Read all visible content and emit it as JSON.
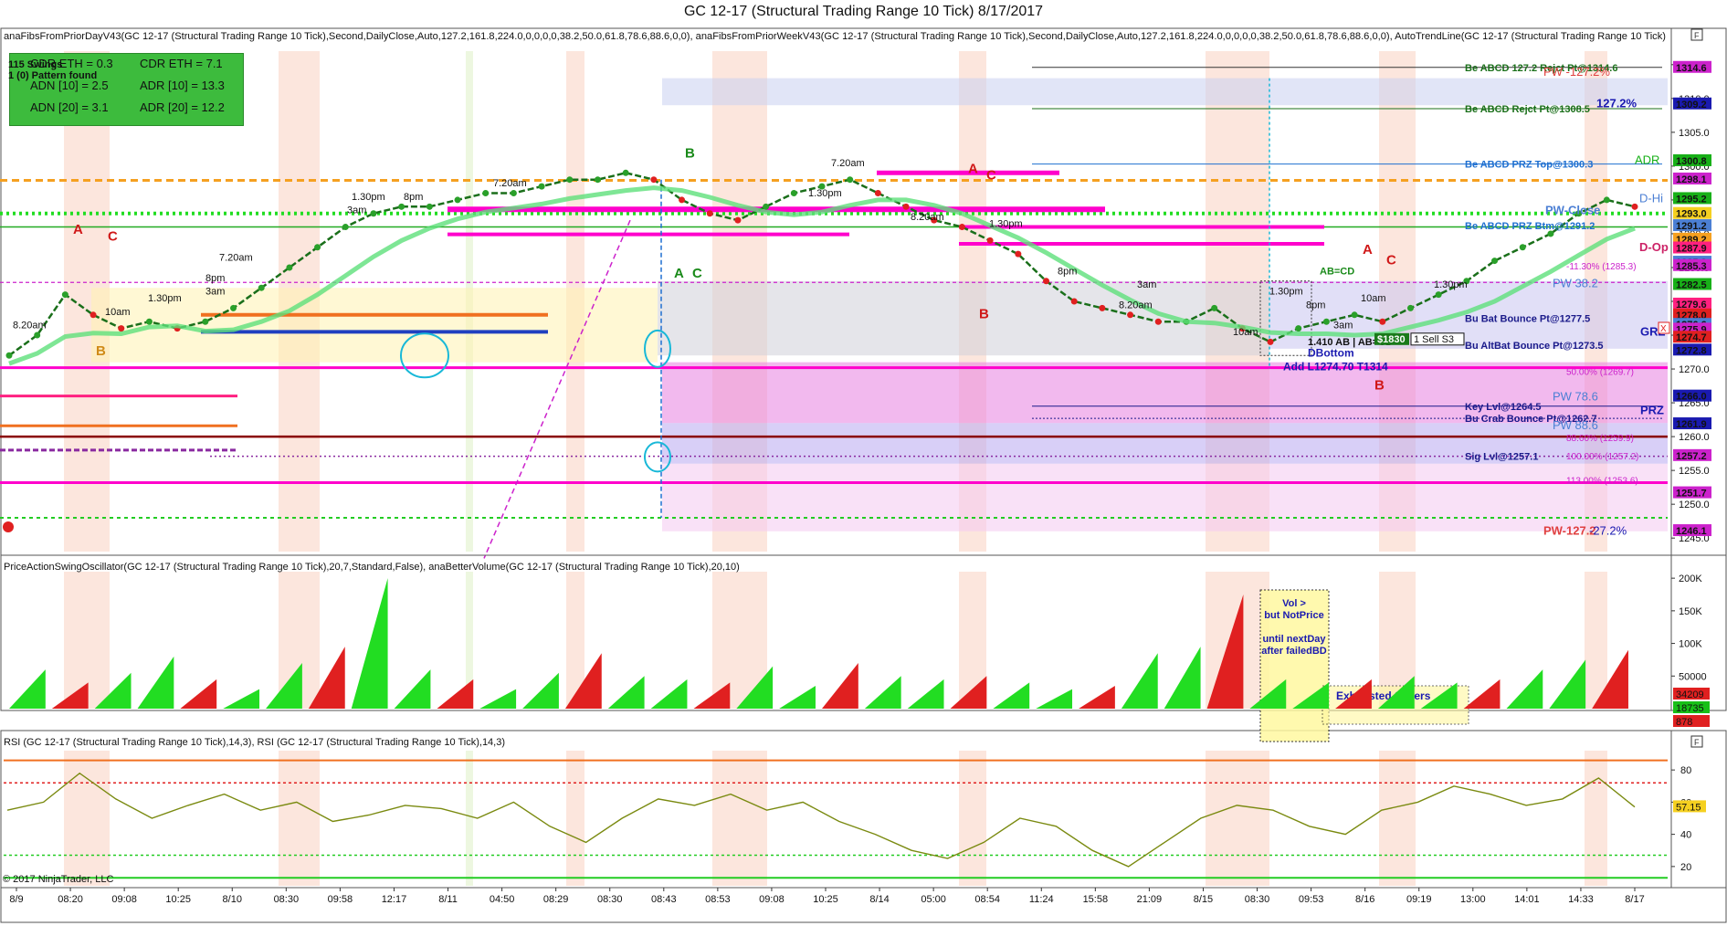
{
  "window": {
    "title": "GC 12-17 (Structural Trading Range 10 Tick)  8/17/2017",
    "copyright": "© 2017 NinjaTrader, LLC"
  },
  "price_panel": {
    "indicator_header": "anaFibsFromPriorDayV43(GC 12-17 (Structural Trading Range 10 Tick),Second,DailyClose,Auto,127.2,161.8,224.0,0,0,0,0,38.2,50.0,61.8,78.6,88.6,0,0), anaFibsFromPriorWeekV43(GC 12-17 (Structural Trading Range 10 Tick),Second,DailyClose,Auto,127.2,161.8,224.0,0,0,0,0,38.2,50.0,61.8,78.6,88.6,0,0), AutoTrendLine(GC 12-17 (Structural Trading Range 10 Tick)",
    "stats": {
      "swings": "115 Swings",
      "pattern": "1 (0) Pattern found",
      "cdr_eth_a": "CDR ETH = 0.3",
      "cdr_eth_b": "CDR ETH = 7.1",
      "adn10": "ADN [10] = 2.5",
      "adr10": "ADR [10] = 13.3",
      "adn20": "ADN [20] = 3.1",
      "adr20": "ADR [20] = 12.2"
    },
    "levels": [
      {
        "text": "Be ABCD 127.2 Rejct Pt@1314.6",
        "color": "#1a6f1a"
      },
      {
        "text": "Be ABCD Rejct Pt@1308.5",
        "color": "#1a6f1a"
      },
      {
        "text": "Be ABCD PRZ Top@1300.3",
        "color": "#1e6fd0"
      },
      {
        "text": "Be ABCD PRZ Btm@1291.2",
        "color": "#1e6fd0"
      },
      {
        "text": "Key Lvl@1264.5",
        "color": "#1a1a8a"
      },
      {
        "text": "Bu Crab Bounce Pt@1262.7",
        "color": "#1a1a8a"
      },
      {
        "text": "Sig Lvl@1257.1",
        "color": "#1a1a8a"
      },
      {
        "text": "Bu Bat Bounce Pt@1277.5",
        "color": "#1a1a8a"
      },
      {
        "text": "Bu AltBat Bounce Pt@1273.5",
        "color": "#1a1a8a"
      }
    ],
    "right_labels": [
      {
        "text": "PW -127.2%",
        "color": "#e04040"
      },
      {
        "text": "127.2%",
        "color": "#1a1ab0"
      },
      {
        "text": "ADR",
        "color": "#18b018"
      },
      {
        "text": "PW-Close",
        "color": "#4b7fd4"
      },
      {
        "text": "D-Hi",
        "color": "#4b7fd4"
      },
      {
        "text": "D-Op",
        "color": "#cc2266"
      },
      {
        "text": "PW 38.2",
        "color": "#4b7fd4"
      },
      {
        "text": "GRZ",
        "color": "#1a1ab0"
      },
      {
        "text": "PW 78.6",
        "color": "#4b7fd4"
      },
      {
        "text": "PRZ",
        "color": "#1a1ab0"
      },
      {
        "text": "PW 88.6",
        "color": "#4b7fd4"
      },
      {
        "text": "PW-127.2",
        "color": "#e04040"
      },
      {
        "text": "-27.2%",
        "color": "#1a1ab0"
      }
    ],
    "annotations": {
      "dbottom": "DBottom",
      "add_order": "Add L1274.70 T1314",
      "ab_cd": "1.410 AB | AB=CD",
      "price_tag": "$1830",
      "sell_tag": "1  Sell S3",
      "abcd": "AB=CD",
      "time_labels": [
        "8.20am",
        "10am",
        "1.30pm",
        "3am",
        "8pm",
        "7.20am",
        "1.30pm",
        "3am",
        "8pm",
        "7.20am",
        "1.30pm",
        "7.20am",
        "8.20am",
        "1.30pm",
        "8pm",
        "1.30pm",
        "10am",
        "3am",
        "8pm",
        "1.30pm",
        "3am",
        "8.20am",
        "10am"
      ],
      "letters": [
        {
          "text": "A",
          "color": "#d01818"
        },
        {
          "text": "C",
          "color": "#d01818"
        },
        {
          "text": "B",
          "color": "#d08a18"
        },
        {
          "text": "B",
          "color": "#1a8a1a"
        },
        {
          "text": "A",
          "color": "#1a8a1a"
        },
        {
          "text": "C",
          "color": "#1a8a1a"
        },
        {
          "text": "A",
          "color": "#d01818"
        },
        {
          "text": "C",
          "color": "#d01818"
        },
        {
          "text": "B",
          "color": "#d01818"
        },
        {
          "text": "A",
          "color": "#d01818"
        },
        {
          "text": "C",
          "color": "#d01818"
        },
        {
          "text": "B",
          "color": "#d01818"
        }
      ]
    }
  },
  "volume_panel": {
    "indicator_header": "PriceActionSwingOscillator(GC 12-17 (Structural Trading Range 10 Tick),20,7,Standard,False), anaBetterVolume(GC 12-17 (Structural Trading Range 10 Tick),20,10)",
    "callout_vol": [
      "Vol >",
      "but NotPrice",
      "",
      "until nextDay",
      "after failedBD"
    ],
    "callout_exhaust": "Exhausted Sellers",
    "readouts": [
      {
        "text": "34209",
        "color": "#e02020"
      },
      {
        "text": "18735",
        "color": "#18c018"
      },
      {
        "text": "878",
        "color": "#e02020"
      }
    ]
  },
  "rsi_panel": {
    "indicator_header": "RSI (GC 12-17 (Structural Trading Range 10 Tick),14,3), RSI (GC 12-17 (Structural Trading Range 10 Tick),14,3)",
    "readout": "57.15"
  },
  "colors": {
    "bull": "#22dd22",
    "bear": "#e02020",
    "rsi_line": "#7a8a10",
    "fib_magenta": "#ff00cc",
    "orange_dash": "#f5a020",
    "green_dot": "#22dd22"
  },
  "chart_data": [
    {
      "type": "line",
      "panel": "price",
      "x_labels": [
        "8/9",
        "08:20",
        "09:08",
        "10:25",
        "8/10",
        "08:30",
        "09:58",
        "12:17",
        "8/11",
        "04:50",
        "08:29",
        "08:30",
        "08:43",
        "08:53",
        "09:08",
        "10:25",
        "8/14",
        "05:00",
        "08:54",
        "11:24",
        "15:58",
        "21:09",
        "8/15",
        "08:30",
        "09:53",
        "8/16",
        "09:19",
        "13:00",
        "14:01",
        "14:33",
        "8/17"
      ],
      "ylim": [
        1243,
        1317
      ],
      "y_ticks": [
        1245.0,
        1250.0,
        1255.0,
        1260.0,
        1265.0,
        1270.0,
        1275.0,
        1280.0,
        1285.0,
        1290.0,
        1295.0,
        1300.0,
        1305.0,
        1310.0,
        1315.0
      ],
      "series": [
        {
          "values": [
            1272,
            1275,
            1281,
            1278,
            1276,
            1277,
            1276,
            1277,
            1279,
            1282,
            1285,
            1288,
            1291,
            1293,
            1294,
            1294,
            1295,
            1296,
            1296,
            1297,
            1298,
            1298,
            1299,
            1298,
            1295,
            1293,
            1292,
            1294,
            1296,
            1297,
            1298,
            1296,
            1294,
            1292,
            1291,
            1289,
            1287,
            1283,
            1280,
            1279,
            1278,
            1277,
            1277,
            1279,
            1276,
            1274,
            1276,
            1277,
            1278,
            1277,
            1279,
            1281,
            1283,
            1286,
            1288,
            1290,
            1293,
            1295,
            1294
          ]
        }
      ],
      "price_tags": [
        {
          "text": "1314.6",
          "value": 1314.6,
          "color": "#cc22cc"
        },
        {
          "text": "1309.2",
          "value": 1309.2,
          "color": "#1a1ab0"
        },
        {
          "text": "1300.8",
          "value": 1300.8,
          "color": "#18b018"
        },
        {
          "text": "1298.1",
          "value": 1298.1,
          "color": "#cc22cc"
        },
        {
          "text": "1295.2",
          "value": 1295.2,
          "color": "#18b018"
        },
        {
          "text": "1293.0",
          "value": 1293.0,
          "color": "#f5d020"
        },
        {
          "text": "1291.2",
          "value": 1291.2,
          "color": "#4b7fd4"
        },
        {
          "text": "1289.2",
          "value": 1289.2,
          "color": "#f5a020"
        },
        {
          "text": "1287.9",
          "value": 1287.9,
          "color": "#ff2080"
        },
        {
          "text": "1285.8",
          "value": 1285.8,
          "color": "#4b7fd4"
        },
        {
          "text": "1285.3",
          "value": 1285.3,
          "color": "#cc22cc"
        },
        {
          "text": "1282.5",
          "value": 1282.5,
          "color": "#18b018"
        },
        {
          "text": "1279.6",
          "value": 1279.6,
          "color": "#ff2080"
        },
        {
          "text": "1278.0",
          "value": 1278.0,
          "color": "#e02020"
        },
        {
          "text": "1276.6",
          "value": 1276.6,
          "color": "#4b7fd4"
        },
        {
          "text": "1275.9",
          "value": 1275.9,
          "color": "#cc22cc"
        },
        {
          "text": "1274.7",
          "value": 1274.7,
          "color": "#e02020"
        },
        {
          "text": "1272.8",
          "value": 1272.8,
          "color": "#1a1ab0"
        },
        {
          "text": "1266.0",
          "value": 1266.0,
          "color": "#1a1ab0"
        },
        {
          "text": "1261.9",
          "value": 1261.9,
          "color": "#1a1ab0"
        },
        {
          "text": "1257.2",
          "value": 1257.2,
          "color": "#cc22cc"
        },
        {
          "text": "1251.7",
          "value": 1251.7,
          "color": "#cc22cc"
        },
        {
          "text": "1246.1",
          "value": 1246.1,
          "color": "#cc22cc"
        }
      ],
      "fib_labels": [
        {
          "text": "-11.30% (1285.3)",
          "value": 1285.3
        },
        {
          "text": "50.00% (1269.7)",
          "value": 1269.7
        },
        {
          "text": "88.60% (1259.9)",
          "value": 1259.9
        },
        {
          "text": "100.00% (1257.2)",
          "value": 1257.2
        },
        {
          "text": "113.00% (1253.6)",
          "value": 1253.6
        }
      ]
    },
    {
      "type": "bar",
      "panel": "volume",
      "ylim": [
        0,
        210000
      ],
      "y_ticks": [
        50000,
        100000,
        150000,
        200000
      ],
      "y_tick_labels": [
        "50000",
        "100K",
        "150K",
        "200K"
      ],
      "series": [
        {
          "name": "",
          "values": [
            60,
            40,
            55,
            80,
            45,
            30,
            70,
            95,
            200,
            60,
            45,
            30,
            55,
            85,
            50,
            45,
            40,
            65,
            35,
            70,
            50,
            45,
            50,
            40,
            30,
            35,
            85,
            95,
            175,
            45,
            40,
            45,
            50,
            40,
            45,
            60,
            75,
            90
          ]
        }
      ]
    },
    {
      "type": "line",
      "panel": "rsi",
      "ylim": [
        8,
        92
      ],
      "y_ticks": [
        20,
        40,
        60,
        80
      ],
      "series": [
        {
          "values": [
            55,
            60,
            78,
            62,
            50,
            58,
            65,
            55,
            60,
            48,
            52,
            58,
            56,
            50,
            60,
            45,
            35,
            50,
            62,
            58,
            65,
            55,
            60,
            48,
            40,
            30,
            25,
            35,
            50,
            45,
            30,
            20,
            35,
            50,
            58,
            55,
            45,
            40,
            55,
            60,
            70,
            65,
            58,
            62,
            75,
            57
          ]
        }
      ]
    }
  ]
}
